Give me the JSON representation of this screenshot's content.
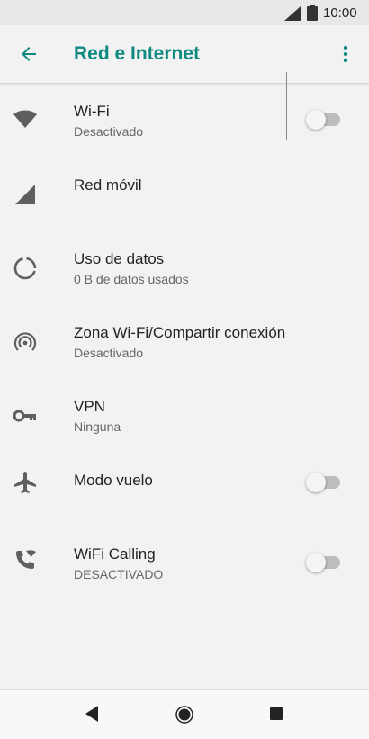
{
  "status": {
    "time": "10:00"
  },
  "appbar": {
    "title": "Red e Internet"
  },
  "items": [
    {
      "title": "Wi-Fi",
      "subtitle": "Desactivado",
      "icon": "wifi-icon",
      "toggle": false
    },
    {
      "title": "Red móvil",
      "subtitle": "",
      "icon": "cell-signal-icon"
    },
    {
      "title": "Uso de datos",
      "subtitle": "0 B de datos usados",
      "icon": "data-usage-icon"
    },
    {
      "title": "Zona Wi-Fi/Compartir conexión",
      "subtitle": "Desactivado",
      "icon": "hotspot-icon"
    },
    {
      "title": "VPN",
      "subtitle": "Ninguna",
      "icon": "vpn-key-icon"
    },
    {
      "title": "Modo vuelo",
      "subtitle": "",
      "icon": "airplane-icon",
      "toggle": false
    },
    {
      "title": "WiFi Calling",
      "subtitle": "DESACTIVADO",
      "icon": "wifi-calling-icon",
      "toggle": false
    }
  ],
  "colors": {
    "accent": "#0f8a80",
    "icon": "#5f5f5f",
    "background": "#f2f2f2"
  }
}
